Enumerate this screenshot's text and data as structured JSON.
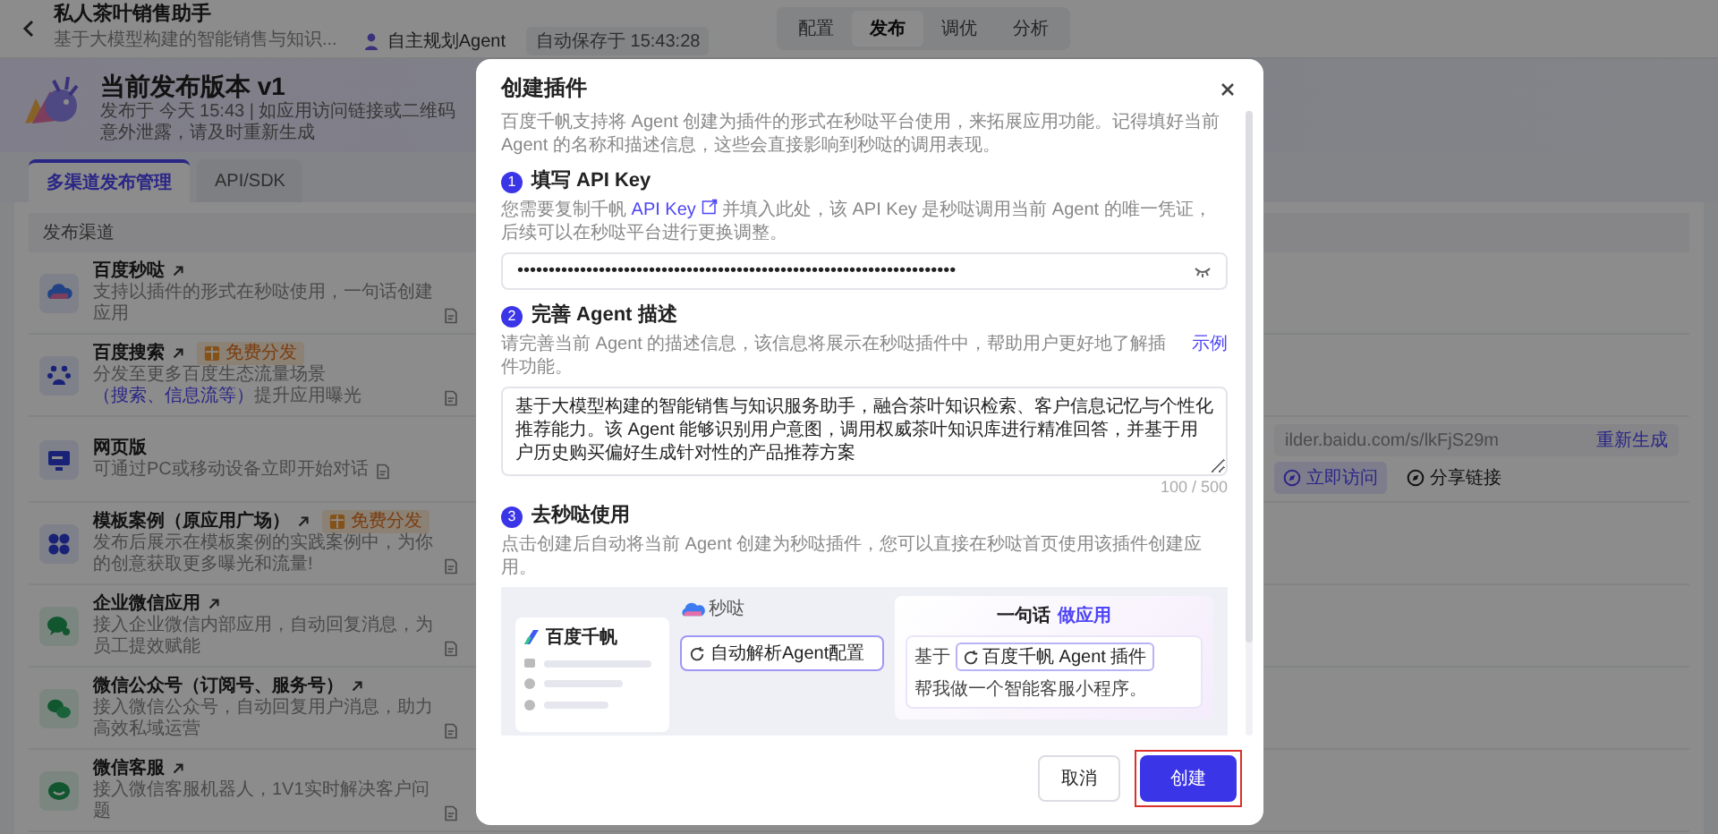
{
  "app": {
    "title": "私人茶叶销售助手",
    "subtitle": "基于大模型构建的智能销售与知识...",
    "agent_badge": "自主规划Agent",
    "autosave": "自动保存于 15:43:28"
  },
  "nav_tabs": [
    {
      "label": "配置",
      "selected": false
    },
    {
      "label": "发布",
      "selected": true
    },
    {
      "label": "调优",
      "selected": false
    },
    {
      "label": "分析",
      "selected": false
    }
  ],
  "release": {
    "title": "当前发布版本 v1",
    "notice": "发布于 今天 15:43 | 如应用访问链接或二维码意外泄露，请及时重新生成"
  },
  "tabs": [
    {
      "label": "多渠道发布管理",
      "selected": true
    },
    {
      "label": "API/SDK",
      "selected": false
    }
  ],
  "channels_header": "发布渠道",
  "channels": [
    {
      "title": "百度秒哒",
      "external": true,
      "desc": "支持以插件的形式在秒哒使用，一句话创建应用"
    },
    {
      "title": "百度搜索",
      "external": true,
      "badge": "免费分发",
      "desc": "分发至更多百度生态流量场景",
      "desc_link": "（搜索、信息流等）",
      "desc_after": "提升应用曝光"
    },
    {
      "title": "网页版",
      "external": false,
      "desc": "可通过PC或移动设备立即开始对话",
      "url": "ilder.baidu.com/s/lkFjS29m",
      "regenerate": "重新生成",
      "actions": [
        "立即访问",
        "分享链接"
      ]
    },
    {
      "title": "模板案例（原应用广场）",
      "external": true,
      "badge": "免费分发",
      "desc": "发布后展示在模板案例的实践案例中，为你的创意获取更多曝光和流量!"
    },
    {
      "title": "企业微信应用",
      "external": true,
      "desc": "接入企业微信内部应用，自动回复消息，为员工提效赋能"
    },
    {
      "title": "微信公众号（订阅号、服务号）",
      "external": true,
      "desc": "接入微信公众号，自动回复用户消息，助力高效私域运营"
    },
    {
      "title": "微信客服",
      "external": true,
      "desc": "接入微信客服机器人，1V1实时解决客户问题"
    }
  ],
  "modal": {
    "title": "创建插件",
    "intro": "百度千帆支持将 Agent 创建为插件的形式在秒哒平台使用，来拓展应用功能。记得填好当前 Agent 的名称和描述信息，这些会直接影响到秒哒的调用表现。",
    "steps": [
      {
        "kind": "secret",
        "number": "1",
        "title": "填写 API Key",
        "desc": "您需要复制千帆",
        "desc_link": "API Key",
        "desc_after": "并填入此处，该 API Key 是秒哒调用当前 Agent 的唯一凭证，后续可以在秒哒平台进行更换调整。",
        "value": "••••••••••••••••••••••••••••••••••••••••••••••••••••••••••••••••••••••"
      },
      {
        "kind": "textarea",
        "number": "2",
        "title": "完善 Agent 描述",
        "desc": "请完善当前 Agent 的描述信息，该信息将展示在秒哒插件中，帮助用户更好地了解插件功能。",
        "example": "示例",
        "value": "基于大模型构建的智能销售与知识服务助手，融合茶叶知识检索、客户信息记忆与个性化推荐能力。该 Agent 能够识别用户意图，调用权威茶叶知识库进行精准回答，并基于用户历史购买偏好生成针对性的产品推荐方案",
        "counter": "100 / 500"
      },
      {
        "kind": "preview",
        "number": "3",
        "title": "去秒哒使用",
        "desc": "点击创建后自动将当前 Agent 创建为秒哒插件，您可以直接在秒哒首页使用该插件创建应用。",
        "preview": {
          "brand": "百度千帆",
          "app_name": "秒哒",
          "config_label": "自动解析Agent配置",
          "headline": "一句话",
          "headline_highlight": "做应用",
          "prompt_prefix": "基于",
          "plugin_chip": "百度千帆 Agent 插件",
          "prompt": "帮我做一个智能客服小程序。"
        }
      }
    ],
    "buttons": [
      {
        "label": "取消",
        "kind": "secondary",
        "highlighted": false
      },
      {
        "label": "创建",
        "kind": "primary",
        "highlighted": true
      }
    ]
  }
}
